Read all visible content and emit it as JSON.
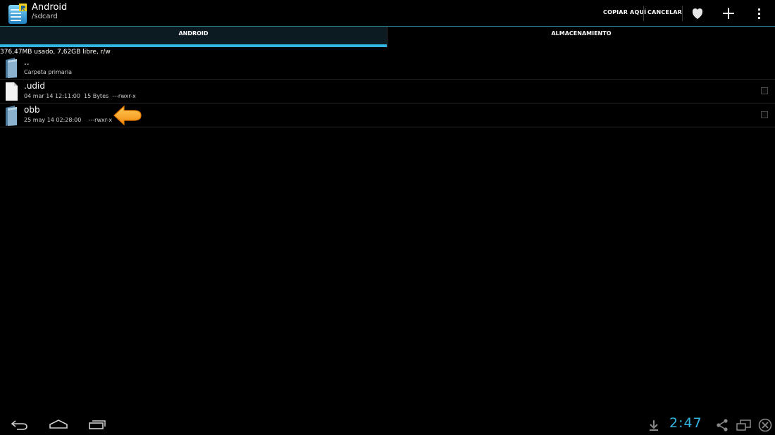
{
  "app": {
    "title": "Android",
    "path": "/sdcard",
    "icon": "file-manager-app-icon"
  },
  "actionbar": {
    "copy_label": "COPIAR AQUÍ",
    "cancel_label": "CANCELAR",
    "icons": [
      "heart-icon",
      "plus-icon",
      "overflow-menu-icon"
    ]
  },
  "tabs": [
    {
      "label": "ANDROID",
      "selected": true
    },
    {
      "label": "ALMACENAMIENTO",
      "selected": false
    }
  ],
  "storage_info": "376,47MB usado, 7,62GB libre, r/w",
  "files": [
    {
      "name": "..",
      "meta": "Carpeta primaria",
      "type": "folder",
      "checkbox": false
    },
    {
      "name": ".udid",
      "meta": "04 mar 14 12:11:00  15 Bytes  ---rwxr-x",
      "type": "file",
      "checkbox": true
    },
    {
      "name": "obb",
      "meta": "25 may 14 02:28:00    ---rwxr-x",
      "type": "folder",
      "checkbox": true
    }
  ],
  "statusbar": {
    "time": "2:47",
    "icons": [
      "download-icon",
      "share-icon",
      "screen-icon",
      "close-circle-icon"
    ]
  },
  "navbar": {
    "icons": [
      "back-icon",
      "home-icon",
      "recents-icon"
    ]
  },
  "colors": {
    "accent": "#33b5e5",
    "background": "#000000",
    "pointer": "#f7941d"
  }
}
